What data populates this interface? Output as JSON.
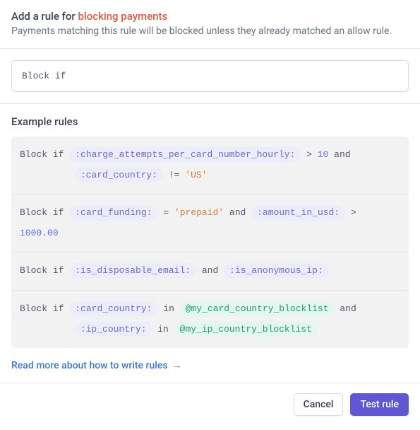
{
  "header": {
    "title_prefix": "Add a rule for ",
    "title_highlight": "blocking payments",
    "subtitle": "Payments matching this rule will be blocked unless they already matched an allow rule."
  },
  "input": {
    "value": "Block if"
  },
  "examples": {
    "label": "Example rules",
    "block_if": "Block if",
    "op_gt": ">",
    "op_neq": "!=",
    "op_eq": "=",
    "op_and": "and",
    "op_in": "in",
    "rule1": {
      "field1": ":charge_attempts_per_card_number_hourly:",
      "val1": "10",
      "field2": ":card_country:",
      "val2": "'US'"
    },
    "rule2": {
      "field1": ":card_funding:",
      "val1": "'prepaid'",
      "field2": ":amount_in_usd:",
      "val2": "1000.00"
    },
    "rule3": {
      "field1": ":is_disposable_email:",
      "field2": ":is_anonymous_ip:"
    },
    "rule4": {
      "field1": ":card_country:",
      "list1": "@my_card_country_blocklist",
      "field2": ":ip_country:",
      "list2": "@my_ip_country_blocklist"
    }
  },
  "readmore": {
    "label": "Read more about how to write rules",
    "arrow": "→"
  },
  "footer": {
    "cancel": "Cancel",
    "test": "Test rule"
  }
}
